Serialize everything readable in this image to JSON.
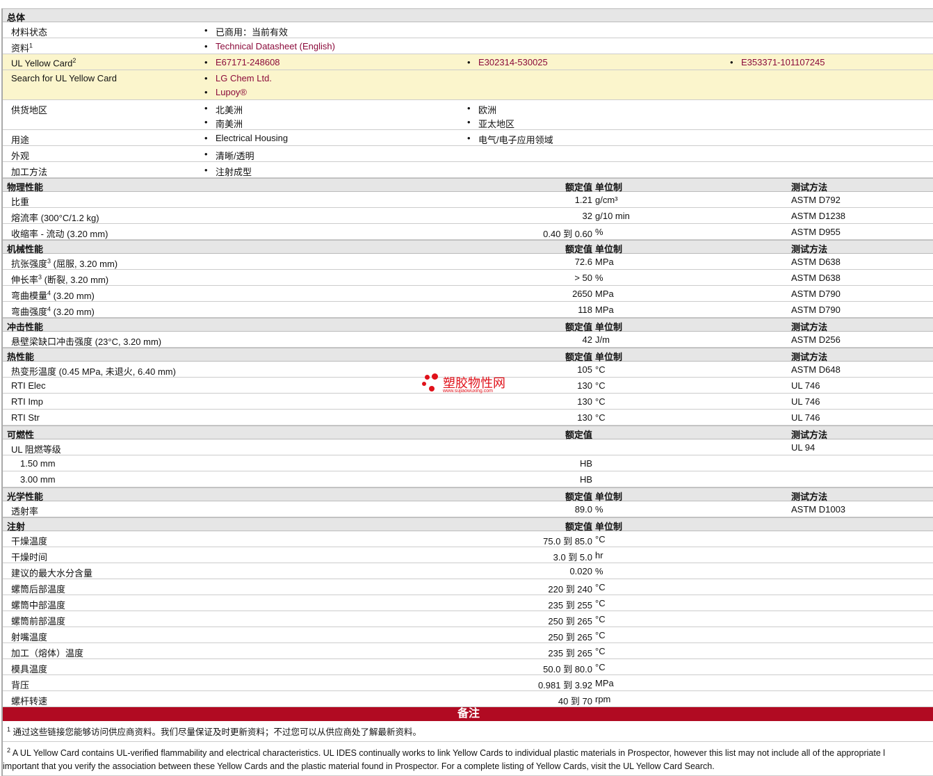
{
  "general": {
    "title": "总体",
    "rows": [
      {
        "label": "材料状态",
        "cols": [
          [
            "已商用：当前有效"
          ]
        ]
      },
      {
        "label": "资料",
        "sup": "1",
        "link": true,
        "cols": [
          [
            "Technical Datasheet (English)"
          ]
        ]
      },
      {
        "label": "UL Yellow Card",
        "sup": "2",
        "link": true,
        "yellow": true,
        "cols": [
          [
            "E67171-248608"
          ],
          [
            "E302314-530025"
          ],
          [
            "E353371-101107245"
          ]
        ]
      },
      {
        "label": "Search for UL Yellow Card",
        "link": true,
        "yellow": true,
        "cols": [
          [
            "LG Chem Ltd.",
            "Lupoy®"
          ]
        ]
      },
      {
        "label": "供货地区",
        "cols": [
          [
            "北美洲",
            "南美洲"
          ],
          [
            "欧洲",
            "亚太地区"
          ]
        ]
      },
      {
        "label": "用途",
        "cols": [
          [
            "Electrical Housing"
          ],
          [
            "电气/电子应用领域"
          ]
        ]
      },
      {
        "label": "外观",
        "cols": [
          [
            "清晰/透明"
          ]
        ]
      },
      {
        "label": "加工方法",
        "cols": [
          [
            "注射成型"
          ]
        ]
      }
    ]
  },
  "sections": [
    {
      "title": "物理性能",
      "h_value": "额定值",
      "h_unit": "单位制",
      "h_method": "测试方法",
      "rows": [
        {
          "label": "比重",
          "value": "1.21",
          "unit": "g/cm³",
          "method": "ASTM D792"
        },
        {
          "label": "熔流率  (300°C/1.2 kg)",
          "value": "32",
          "unit": "g/10 min",
          "method": "ASTM D1238"
        },
        {
          "label": "收缩率  - 流动  (3.20 mm)",
          "value": "0.40 到  0.60",
          "unit": "%",
          "method": "ASTM D955"
        }
      ]
    },
    {
      "title": "机械性能",
      "h_value": "额定值",
      "h_unit": "单位制",
      "h_method": "测试方法",
      "rows": [
        {
          "label": "抗张强度",
          "sup": "3",
          "label2": " (屈服, 3.20 mm)",
          "value": "72.6",
          "unit": "MPa",
          "method": "ASTM D638"
        },
        {
          "label": "伸长率",
          "sup": "3",
          "label2": " (断裂, 3.20 mm)",
          "value": "> 50",
          "unit": "%",
          "method": "ASTM D638"
        },
        {
          "label": "弯曲模量",
          "sup": "4",
          "label2": " (3.20 mm)",
          "value": "2650",
          "unit": "MPa",
          "method": "ASTM D790"
        },
        {
          "label": "弯曲强度",
          "sup": "4",
          "label2": " (3.20 mm)",
          "value": "118",
          "unit": "MPa",
          "method": "ASTM D790"
        }
      ]
    },
    {
      "title": "冲击性能",
      "h_value": "额定值",
      "h_unit": "单位制",
      "h_method": "测试方法",
      "rows": [
        {
          "label": "悬壁梁缺口冲击强度  (23°C, 3.20 mm)",
          "value": "42",
          "unit": "J/m",
          "method": "ASTM D256"
        }
      ]
    },
    {
      "title": "热性能",
      "h_value": "额定值",
      "h_unit": "单位制",
      "h_method": "测试方法",
      "rows": [
        {
          "label": "热变形温度  (0.45 MPa, 未退火, 6.40 mm)",
          "value": "105",
          "unit": "°C",
          "method": "ASTM D648"
        },
        {
          "label": "RTI Elec",
          "value": "130",
          "unit": "°C",
          "method": "UL 746"
        },
        {
          "label": "RTI Imp",
          "value": "130",
          "unit": "°C",
          "method": "UL 746"
        },
        {
          "label": "RTI Str",
          "value": "130",
          "unit": "°C",
          "method": "UL 746"
        }
      ]
    },
    {
      "title": "可燃性",
      "h_value": "额定值",
      "h_method": "测试方法",
      "rows": [
        {
          "label": "UL 阻燃等级",
          "method": "UL 94"
        },
        {
          "label": "1.50 mm",
          "indent": true,
          "value": "HB"
        },
        {
          "label": "3.00 mm",
          "indent": true,
          "value": "HB"
        }
      ]
    },
    {
      "title": "光学性能",
      "h_value": "额定值",
      "h_unit": "单位制",
      "h_method": "测试方法",
      "rows": [
        {
          "label": "透射率",
          "value": "89.0",
          "unit": "%",
          "method": "ASTM D1003"
        }
      ]
    },
    {
      "title": "注射",
      "h_value": "额定值",
      "h_unit": "单位制",
      "rows": [
        {
          "label": "干燥温度",
          "value": "75.0 到  85.0",
          "unit": "°C"
        },
        {
          "label": "干燥时间",
          "value": "3.0 到  5.0",
          "unit": "hr"
        },
        {
          "label": "建议的最大水分含量",
          "value": "0.020",
          "unit": "%"
        },
        {
          "label": "螺筒后部温度",
          "value": "220 到  240",
          "unit": "°C"
        },
        {
          "label": "螺筒中部温度",
          "value": "235 到  255",
          "unit": "°C"
        },
        {
          "label": "螺筒前部温度",
          "value": "250 到  265",
          "unit": "°C"
        },
        {
          "label": "射嘴温度",
          "value": "250 到  265",
          "unit": "°C"
        },
        {
          "label": "加工（熔体）温度",
          "value": "235 到  265",
          "unit": "°C"
        },
        {
          "label": "模具温度",
          "value": "50.0 到  80.0",
          "unit": "°C"
        },
        {
          "label": "背压",
          "value": "0.981 到  3.92",
          "unit": "MPa"
        },
        {
          "label": "螺杆转速",
          "value": "40 到  70",
          "unit": "rpm"
        }
      ]
    }
  ],
  "notes": {
    "title": "备注",
    "items": [
      {
        "n": "1",
        "lines": [
          "通过这些链接您能够访问供应商资料。我们尽量保证及时更新资料；不过您可以从供应商处了解最新资料。"
        ]
      },
      {
        "n": "2",
        "lines": [
          "A UL Yellow Card contains UL-verified flammability and electrical characteristics. UL IDES continually works to link Yellow Cards to individual plastic materials in Prospector, however this list may not include all of the appropriate l",
          "important that you verify the association between these Yellow Cards and the plastic material found in Prospector. For a complete listing of Yellow Cards, visit the UL Yellow Card Search."
        ]
      }
    ]
  },
  "watermark": {
    "name": "塑胶物性网",
    "url": "www.sujiaowuxing.com"
  }
}
